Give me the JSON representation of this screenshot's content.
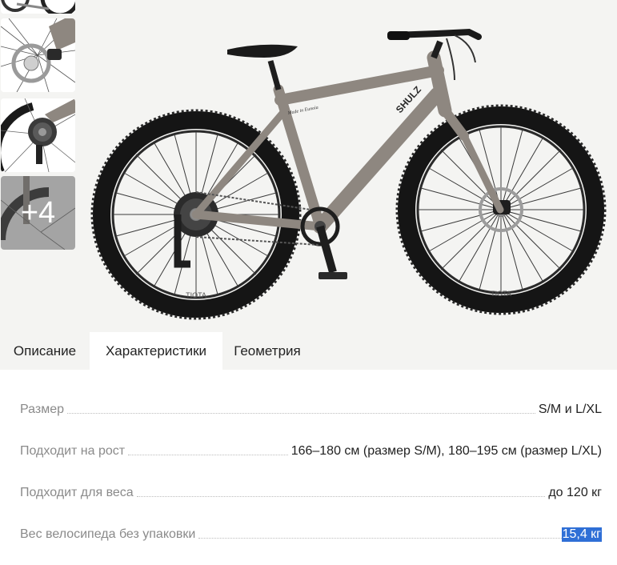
{
  "gallery": {
    "thumbnails": [
      {
        "name": "wheel-top-thumb"
      },
      {
        "name": "front-brake-thumb"
      },
      {
        "name": "rear-cassette-thumb"
      },
      {
        "name": "more-photos-thumb",
        "overlay_label": "+4"
      }
    ],
    "main_image": {
      "frame_brand": "SHULZ",
      "top_tube_script": "Made in Eunoia",
      "tire_brand": "TIOTA"
    }
  },
  "tabs": [
    {
      "label": "Описание",
      "active": false
    },
    {
      "label": "Характеристики",
      "active": true
    },
    {
      "label": "Геометрия",
      "active": false
    }
  ],
  "specs": [
    {
      "label": "Размер",
      "value": "S/M и L/XL",
      "highlighted": false
    },
    {
      "label": "Подходит на рост",
      "value": "166–180 см (размер S/M), 180–195 см (размер L/XL)",
      "highlighted": false
    },
    {
      "label": "Подходит для веса",
      "value": "до 120 кг",
      "highlighted": false
    },
    {
      "label": "Вес велосипеда без упаковки",
      "value": "15,4 кг",
      "highlighted": true
    }
  ],
  "colors": {
    "background": "#f4f4f2",
    "frame": "#8e8780",
    "tire": "#1a1a1a",
    "highlight": "#2f6fd6",
    "label": "#8a8a8a",
    "text": "#222222"
  }
}
